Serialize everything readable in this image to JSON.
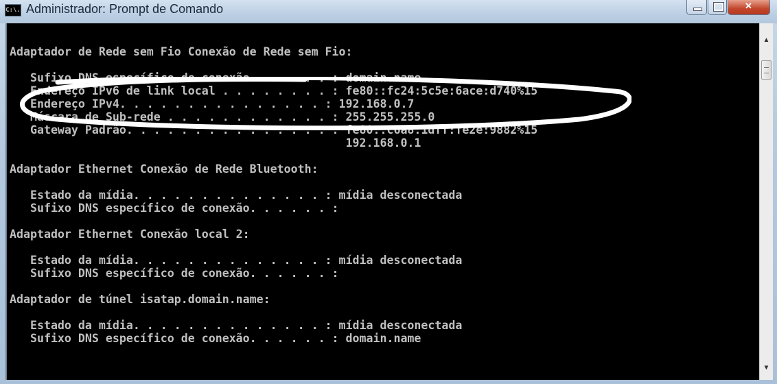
{
  "window": {
    "title": "Administrador: Prompt de Comando",
    "icon_text": "C:\\."
  },
  "console": {
    "lines": [
      "Adaptador de Rede sem Fio Conexão de Rede sem Fio:",
      "",
      "   Sufixo DNS específico de conexão. . . . . . : domain.name",
      "   Endereço IPv6 de link local . . . . . . . . : fe80::fc24:5c5e:6ace:d740%15",
      "   Endereço IPv4. . . . . . . . . . . . . . . : 192.168.0.7",
      "   Máscara de Sub-rede . . . . . . . . . . . . : 255.255.255.0",
      "   Gateway Padrão. . . . . . . . . . . . . . . : fe80::c6a8:1dff:fe2e:9882%15",
      "                                                 192.168.0.1",
      "",
      "Adaptador Ethernet Conexão de Rede Bluetooth:",
      "",
      "   Estado da mídia. . . . . . . . . . . . . . : mídia desconectada",
      "   Sufixo DNS específico de conexão. . . . . . :",
      "",
      "Adaptador Ethernet Conexão local 2:",
      "",
      "   Estado da mídia. . . . . . . . . . . . . . : mídia desconectada",
      "   Sufixo DNS específico de conexão. . . . . . :",
      "",
      "Adaptador de túnel isatap.domain.name:",
      "",
      "   Estado da mídia. . . . . . . . . . . . . . : mídia desconectada",
      "   Sufixo DNS específico de conexão. . . . . . : domain.name"
    ]
  },
  "annotation": {
    "highlighted_line": "Endereço IPv4"
  },
  "colors": {
    "console_bg": "#000000",
    "console_text": "#c0c0c0",
    "annotation_stroke": "#ffffff"
  }
}
